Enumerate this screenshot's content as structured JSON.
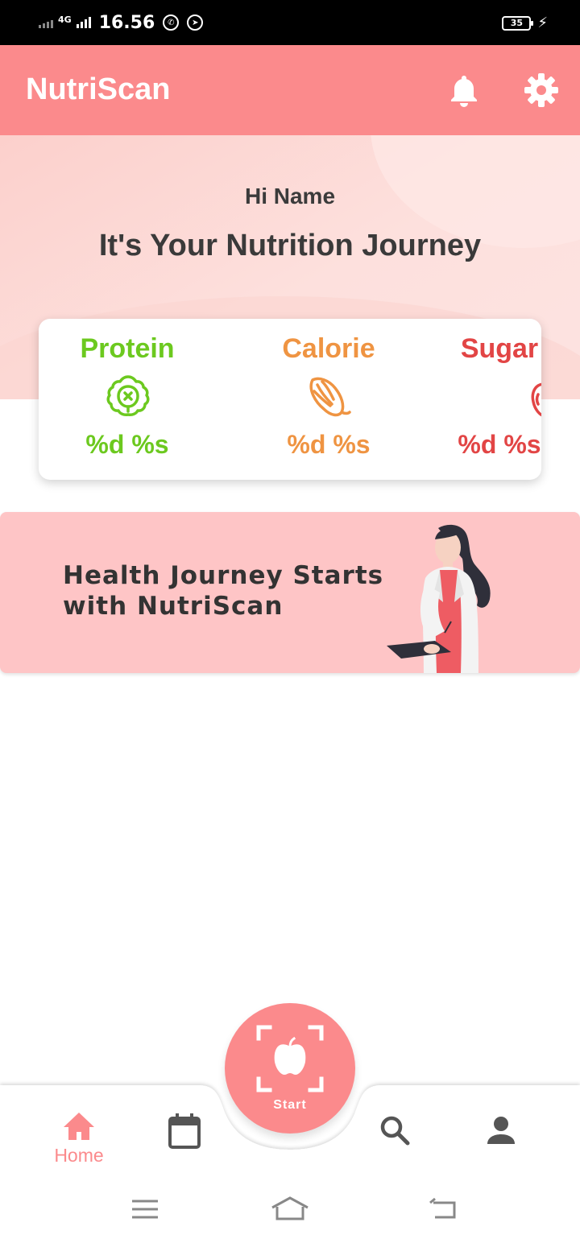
{
  "status_bar": {
    "network": "4G",
    "time": "16.56",
    "battery": "35"
  },
  "app_bar": {
    "title": "NutriScan",
    "icons": [
      "bell-icon",
      "gear-icon"
    ]
  },
  "hero": {
    "greeting": "Hi Name",
    "tagline": "It's Your Nutrition Journey"
  },
  "nutrition": {
    "metrics": [
      {
        "label": "Protein",
        "value": "%d %s",
        "icon": "lettuce-icon",
        "color": "#6cc91f"
      },
      {
        "label": "Calorie",
        "value": "%d %s",
        "icon": "food-icon",
        "color": "#ef9442"
      },
      {
        "label": "Sugar",
        "value": "%d %s",
        "icon": "apple-icon",
        "color": "#e24545"
      }
    ]
  },
  "banner": {
    "text_line1": "Health Journey Starts",
    "text_line2": "with NutriScan"
  },
  "bottom_nav": {
    "home_label": "Home",
    "start_label": "Start",
    "accent": "#fb8a8c",
    "icons": [
      "home-icon",
      "calendar-icon",
      "scan-icon",
      "search-icon",
      "person-icon"
    ]
  },
  "system_nav": {
    "icons": [
      "menu-icon",
      "home-outline-icon",
      "back-icon"
    ]
  }
}
